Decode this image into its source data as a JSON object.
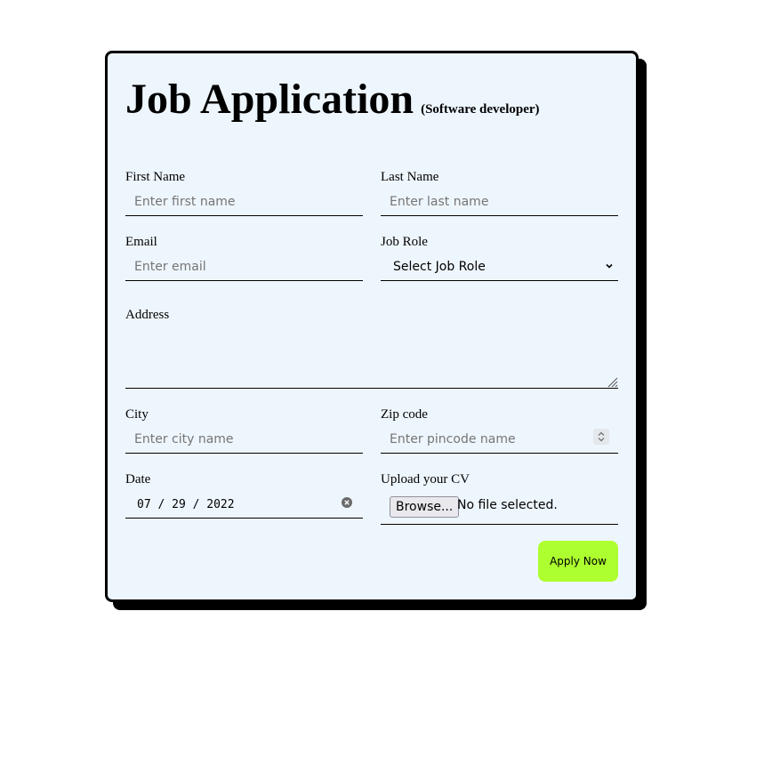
{
  "form": {
    "title": "Job Application",
    "subtitle": "(Software developer)",
    "first_name": {
      "label": "First Name",
      "placeholder": "Enter first name"
    },
    "last_name": {
      "label": "Last Name",
      "placeholder": "Enter last name"
    },
    "email": {
      "label": "Email",
      "placeholder": "Enter email"
    },
    "job_role": {
      "label": "Job Role",
      "selected": "Select Job Role"
    },
    "address": {
      "label": "Address"
    },
    "city": {
      "label": "City",
      "placeholder": "Enter city name"
    },
    "zip": {
      "label": "Zip code",
      "placeholder": "Enter pincode name"
    },
    "date": {
      "label": "Date",
      "value": "07 / 29 / 2022"
    },
    "cv": {
      "label": "Upload your CV",
      "browse_label": "Browse...",
      "status": "No file selected."
    },
    "submit_label": "Apply Now"
  },
  "colors": {
    "card_background": "#eef6fd",
    "submit_button": "#adff2f",
    "shadow": "#000000"
  },
  "icons": {
    "job_role_dropdown": "chevron-down-icon",
    "zip_stepper": "spinner-icon",
    "date_clear": "clear-icon",
    "address_resize": "resize-handle-icon"
  }
}
